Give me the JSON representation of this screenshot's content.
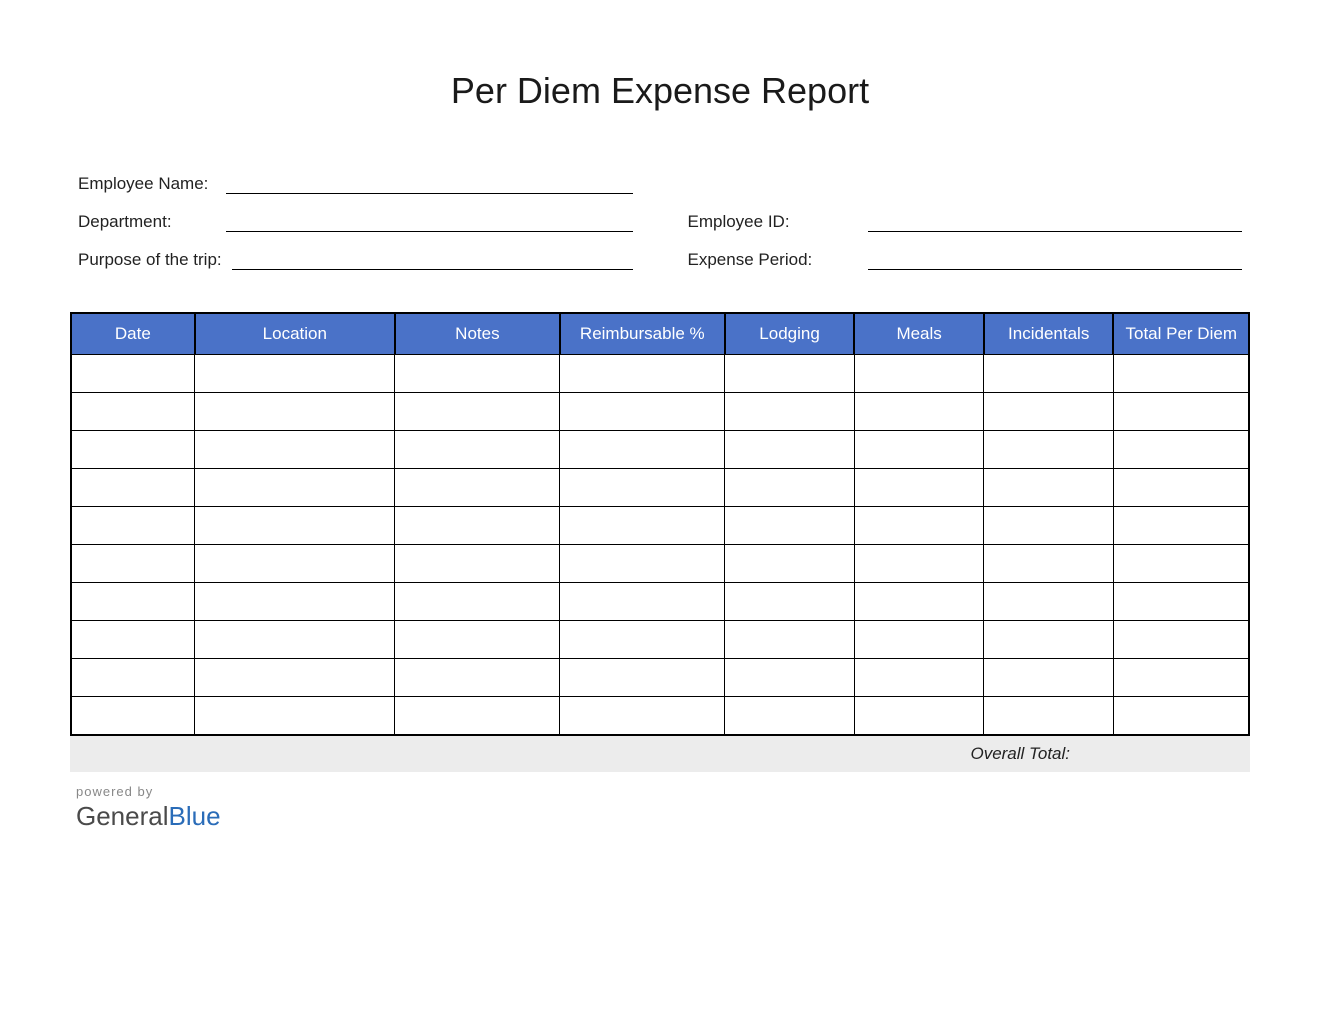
{
  "title": "Per Diem Expense Report",
  "info": {
    "employee_name_label": "Employee Name:",
    "department_label": "Department:",
    "purpose_label": "Purpose of the trip:",
    "employee_id_label": "Employee ID:",
    "expense_period_label": "Expense Period:",
    "employee_name_value": "",
    "department_value": "",
    "purpose_value": "",
    "employee_id_value": "",
    "expense_period_value": ""
  },
  "table": {
    "headers": {
      "date": "Date",
      "location": "Location",
      "notes": "Notes",
      "reimbursable": "Reimbursable %",
      "lodging": "Lodging",
      "meals": "Meals",
      "incidentals": "Incidentals",
      "total": "Total Per Diem"
    },
    "rows": [
      {
        "date": "",
        "location": "",
        "notes": "",
        "reimbursable": "",
        "lodging": "",
        "meals": "",
        "incidentals": "",
        "total": ""
      },
      {
        "date": "",
        "location": "",
        "notes": "",
        "reimbursable": "",
        "lodging": "",
        "meals": "",
        "incidentals": "",
        "total": ""
      },
      {
        "date": "",
        "location": "",
        "notes": "",
        "reimbursable": "",
        "lodging": "",
        "meals": "",
        "incidentals": "",
        "total": ""
      },
      {
        "date": "",
        "location": "",
        "notes": "",
        "reimbursable": "",
        "lodging": "",
        "meals": "",
        "incidentals": "",
        "total": ""
      },
      {
        "date": "",
        "location": "",
        "notes": "",
        "reimbursable": "",
        "lodging": "",
        "meals": "",
        "incidentals": "",
        "total": ""
      },
      {
        "date": "",
        "location": "",
        "notes": "",
        "reimbursable": "",
        "lodging": "",
        "meals": "",
        "incidentals": "",
        "total": ""
      },
      {
        "date": "",
        "location": "",
        "notes": "",
        "reimbursable": "",
        "lodging": "",
        "meals": "",
        "incidentals": "",
        "total": ""
      },
      {
        "date": "",
        "location": "",
        "notes": "",
        "reimbursable": "",
        "lodging": "",
        "meals": "",
        "incidentals": "",
        "total": ""
      },
      {
        "date": "",
        "location": "",
        "notes": "",
        "reimbursable": "",
        "lodging": "",
        "meals": "",
        "incidentals": "",
        "total": ""
      },
      {
        "date": "",
        "location": "",
        "notes": "",
        "reimbursable": "",
        "lodging": "",
        "meals": "",
        "incidentals": "",
        "total": ""
      }
    ]
  },
  "overall_total_label": "Overall Total:",
  "overall_total_value": "",
  "footer": {
    "powered_by": "powered by",
    "brand_general": "General",
    "brand_blue": "Blue"
  },
  "colors": {
    "header_bg": "#4a72c8",
    "header_fg": "#ffffff",
    "total_bg": "#ececec"
  }
}
